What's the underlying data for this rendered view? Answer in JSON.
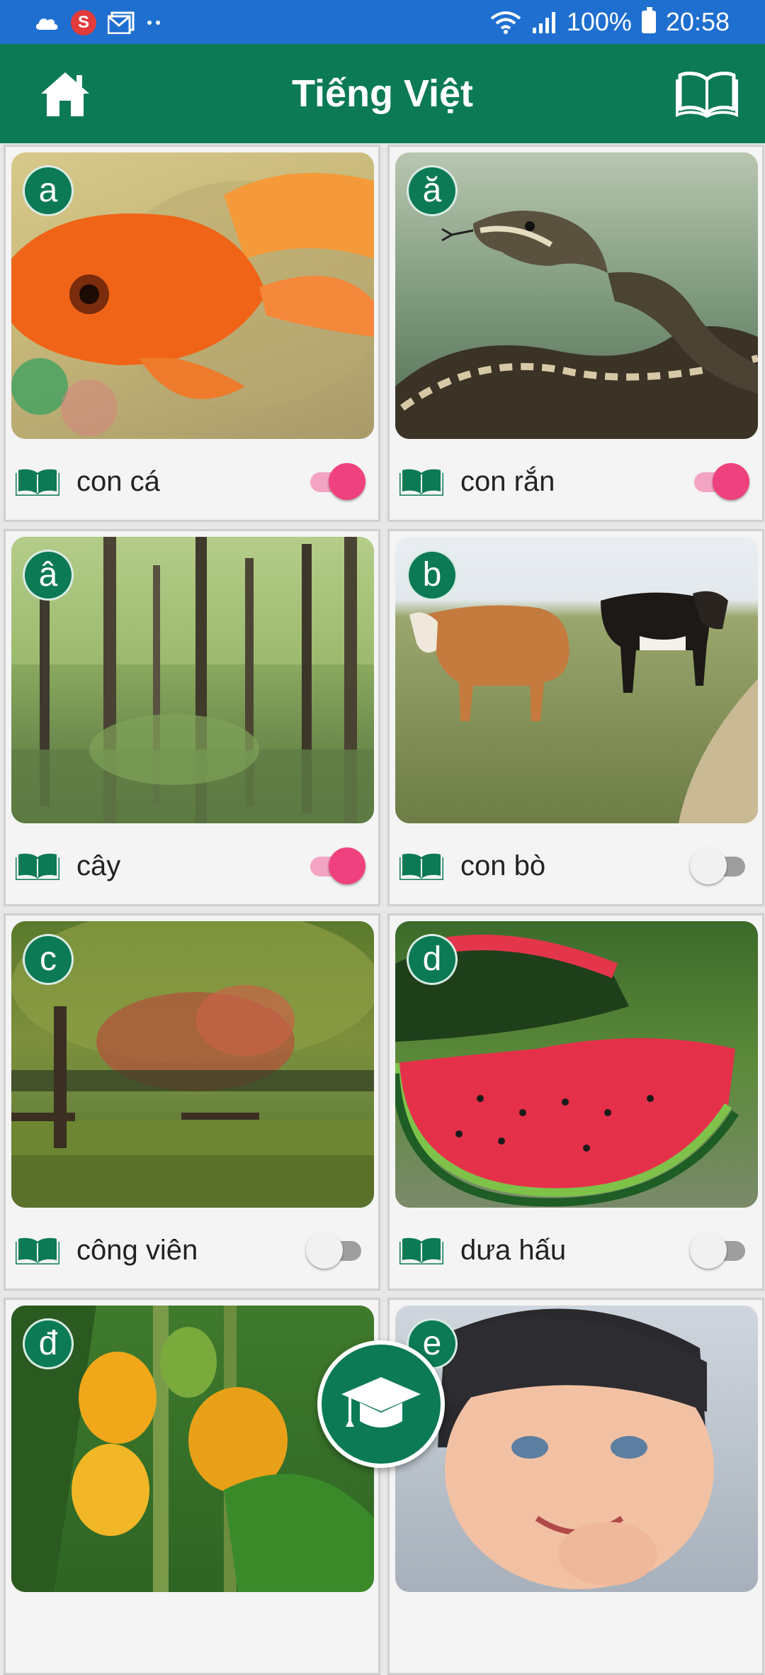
{
  "status_bar": {
    "battery": "100%",
    "time": "20:58",
    "notification_badge": "S"
  },
  "app_bar": {
    "title": "Tiếng Việt",
    "left_icon": "home-icon",
    "right_icon": "book-open-icon"
  },
  "colors": {
    "primary": "#0b7a55",
    "status_bar": "#1f6fd0",
    "toggle_on": "#f0417f"
  },
  "cards": [
    {
      "letter": "a",
      "word": "con cá",
      "toggle_on": true,
      "image": "goldfish"
    },
    {
      "letter": "ă",
      "word": "con rắn",
      "toggle_on": true,
      "image": "snake"
    },
    {
      "letter": "â",
      "word": "cây",
      "toggle_on": true,
      "image": "forest trees"
    },
    {
      "letter": "b",
      "word": "con bò",
      "toggle_on": false,
      "image": "cows"
    },
    {
      "letter": "c",
      "word": "công viên",
      "toggle_on": false,
      "image": "park"
    },
    {
      "letter": "d",
      "word": "dưa hấu",
      "toggle_on": false,
      "image": "watermelon"
    },
    {
      "letter": "đ",
      "word": "",
      "toggle_on": null,
      "image": "papaya"
    },
    {
      "letter": "e",
      "word": "",
      "toggle_on": null,
      "image": "baby"
    }
  ],
  "fab": {
    "icon": "graduation-cap-icon"
  }
}
